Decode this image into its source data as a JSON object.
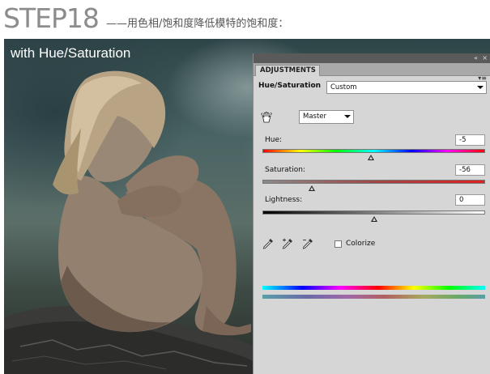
{
  "header": {
    "step_title": "STEP18",
    "description": "——用色相/饱和度降低模特的饱和度："
  },
  "photo": {
    "caption": "with Hue/Saturation"
  },
  "panel": {
    "tab_label": "ADJUSTMENTS",
    "collapse_glyph": "«",
    "close_glyph": "×",
    "menu_glyph": "▾≡",
    "adjustment_name": "Hue/Saturation",
    "preset": {
      "selected": "Custom"
    },
    "channel": {
      "selected": "Master"
    },
    "hue": {
      "label": "Hue:",
      "value": "-5",
      "position": -5,
      "range": [
        -180,
        180
      ]
    },
    "saturation": {
      "label": "Saturation:",
      "value": "-56",
      "position": -56,
      "range": [
        -100,
        100
      ]
    },
    "lightness": {
      "label": "Lightness:",
      "value": "0",
      "position": 0,
      "range": [
        -100,
        100
      ]
    },
    "colorize": {
      "label": "Colorize",
      "checked": false
    },
    "icons": [
      "hand-adjust-icon",
      "eyedropper-icon",
      "eyedropper-plus-icon",
      "eyedropper-minus-icon"
    ]
  }
}
